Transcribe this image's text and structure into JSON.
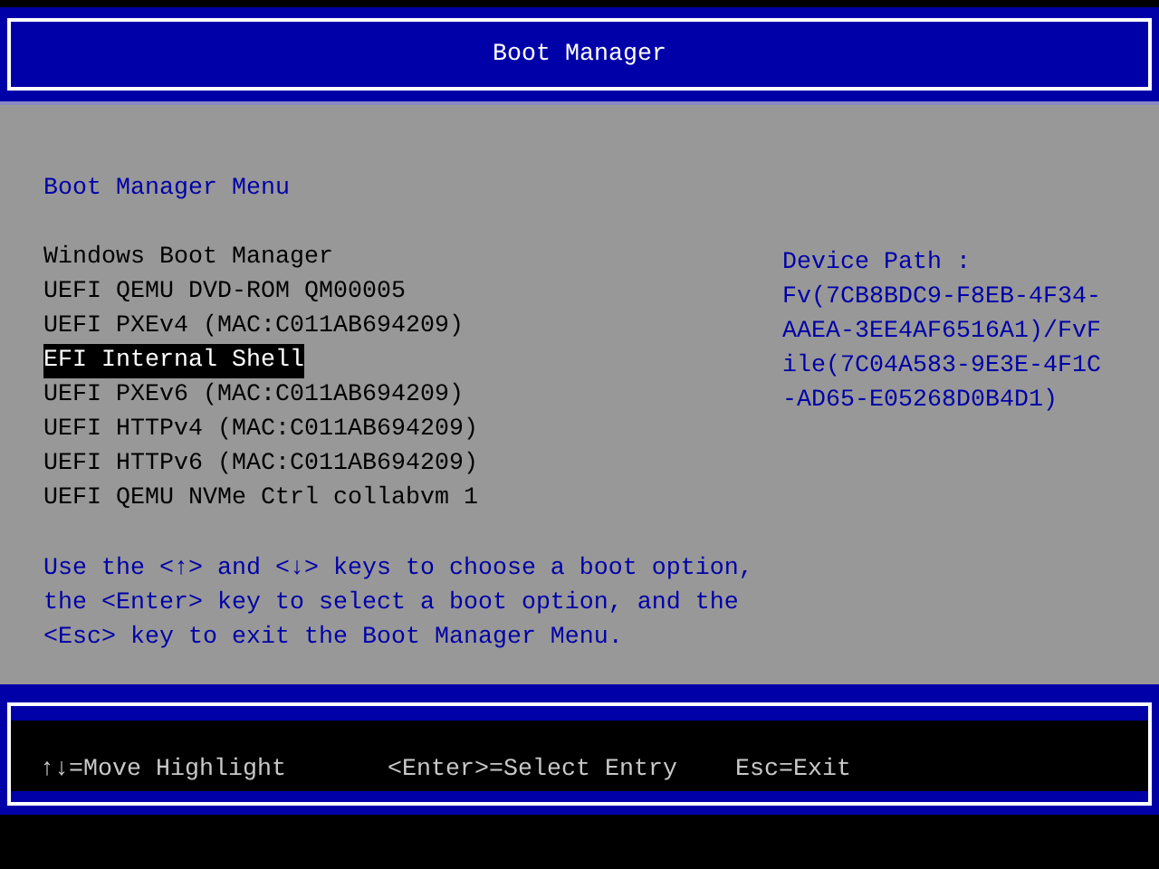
{
  "header": {
    "title": "Boot Manager"
  },
  "menu": {
    "title": "Boot Manager Menu",
    "items": [
      {
        "label": "Windows Boot Manager",
        "selected": false
      },
      {
        "label": "UEFI QEMU DVD-ROM QM00005",
        "selected": false
      },
      {
        "label": "UEFI PXEv4 (MAC:C011AB694209)",
        "selected": false
      },
      {
        "label": "EFI Internal Shell",
        "selected": true
      },
      {
        "label": "UEFI PXEv6 (MAC:C011AB694209)",
        "selected": false
      },
      {
        "label": "UEFI HTTPv4 (MAC:C011AB694209)",
        "selected": false
      },
      {
        "label": "UEFI HTTPv6 (MAC:C011AB694209)",
        "selected": false
      },
      {
        "label": "UEFI QEMU NVMe Ctrl collabvm 1",
        "selected": false
      }
    ],
    "help_lines": [
      "Use the <↑> and <↓> keys to choose a boot option,",
      "the <Enter> key to select a boot option, and the",
      "<Esc> key to exit the Boot Manager Menu."
    ]
  },
  "device_path": {
    "label": "Device Path :",
    "lines": [
      "Fv(7CB8BDC9-F8EB-4F34-",
      "AAEA-3EE4AF6516A1)/FvF",
      "ile(7C04A583-9E3E-4F1C",
      "-AD65-E05268D0B4D1)"
    ]
  },
  "footer": {
    "hints": [
      "↑↓=Move Highlight",
      "<Enter>=Select Entry",
      "Esc=Exit"
    ]
  }
}
